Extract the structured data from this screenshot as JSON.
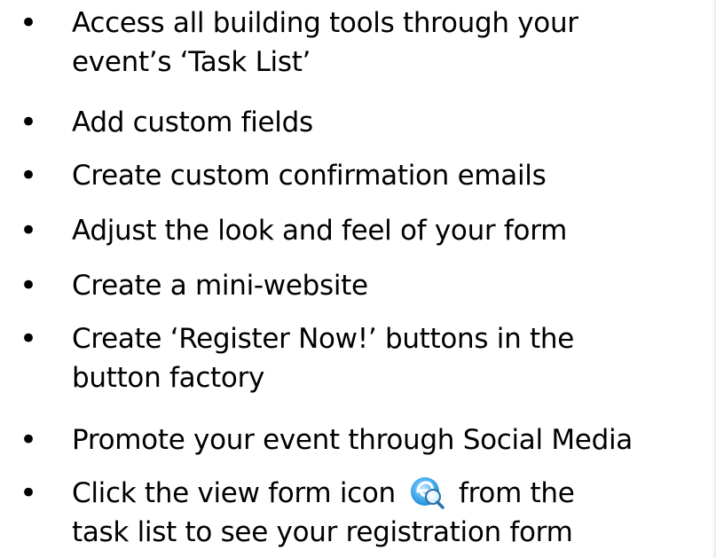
{
  "bullets": [
    {
      "lines": [
        "Access all building tools through your",
        "event’s ‘Task List’"
      ]
    },
    {
      "lines": [
        "Add custom fields"
      ]
    },
    {
      "lines": [
        "Create custom confirmation emails"
      ]
    },
    {
      "lines": [
        "Adjust the look and feel of your form"
      ]
    },
    {
      "lines": [
        "Create a mini-website"
      ]
    },
    {
      "lines": [
        "Create ‘Register Now!’ buttons in the",
        "button factory"
      ]
    },
    {
      "lines": [
        "Promote your event through Social Media"
      ]
    },
    {
      "lines": [
        "Click the view form icon",
        "task list to see your registration form"
      ],
      "inline_after_icon": "from the"
    }
  ],
  "bullet_glyph": "•",
  "icons": {
    "view_form_icon": "view-form-icon"
  },
  "colors": {
    "text": "#000000",
    "icon_blue": "#1f8fd8",
    "icon_light": "#bfe6ff"
  }
}
